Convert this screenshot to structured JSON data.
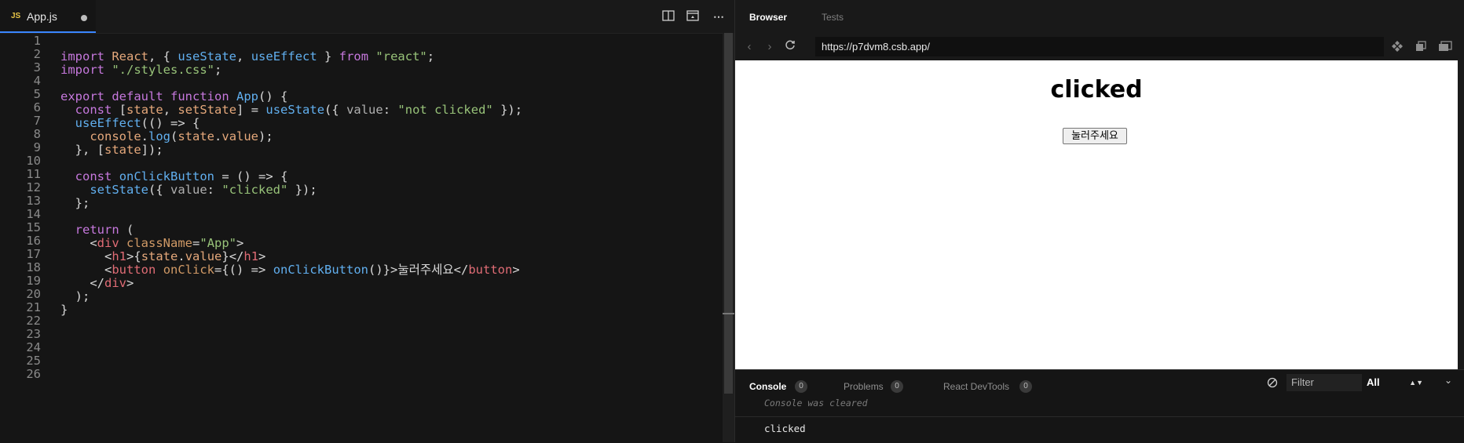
{
  "editor": {
    "tab": {
      "badge": "JS",
      "filename": "App.js"
    },
    "line_numbers": [
      "1",
      "2",
      "3",
      "4",
      "5",
      "6",
      "7",
      "8",
      "9",
      "10",
      "11",
      "12",
      "13",
      "14",
      "15",
      "16",
      "17",
      "18",
      "19",
      "20",
      "21",
      "22",
      "23",
      "24",
      "25",
      "26"
    ],
    "code": {
      "l1": [
        "import",
        "React",
        ", {",
        "useState",
        ",",
        "useEffect",
        "}",
        "from",
        "\"react\"",
        ";"
      ],
      "l2": [
        "import",
        "\"./styles.css\"",
        ";"
      ],
      "l4": [
        "export",
        "default",
        "function",
        "App",
        "() {"
      ],
      "l5": [
        "const",
        "[",
        "state",
        ",",
        "setState",
        "] =",
        "useState",
        "({",
        "value",
        ":",
        "\"not clicked\"",
        "});"
      ],
      "l6": [
        "useEffect",
        "(() =>",
        "{"
      ],
      "l7": [
        "console",
        ".",
        "log",
        "(",
        "state",
        ".",
        "value",
        ");"
      ],
      "l8": [
        "}, [",
        "state",
        "]);"
      ],
      "l10": [
        "const",
        "onClickButton",
        "=",
        "() =>",
        "{"
      ],
      "l11": [
        "setState",
        "({",
        "value",
        ":",
        "\"clicked\"",
        "});"
      ],
      "l12": [
        "};"
      ],
      "l14": [
        "return",
        "("
      ],
      "l15": [
        "<",
        "div",
        "className",
        "=",
        "\"App\"",
        ">"
      ],
      "l16": [
        "<",
        "h1",
        ">{",
        "state",
        ".",
        "value",
        "}</",
        "h1",
        ">"
      ],
      "l17": [
        "<",
        "button",
        "onClick",
        "={() =>",
        "onClickButton",
        "()}>",
        "눌러주세요",
        "</",
        "button",
        ">"
      ],
      "l18": [
        "</",
        "div",
        ">"
      ],
      "l19": [
        ");"
      ],
      "l20": [
        "}"
      ]
    }
  },
  "browser": {
    "tabs": [
      "Browser",
      "Tests"
    ],
    "url": "https://p7dvm8.csb.app/",
    "preview": {
      "heading": "clicked",
      "button_label": "눌러주세요"
    }
  },
  "console": {
    "tabs": [
      {
        "label": "Console",
        "count": "0"
      },
      {
        "label": "Problems",
        "count": "0"
      },
      {
        "label": "React DevTools",
        "count": "0"
      }
    ],
    "filter_placeholder": "Filter",
    "level_select": "All",
    "cleared_message": "Console was cleared",
    "log": "clicked"
  },
  "colors": {
    "accent": "#3a86ff",
    "background": "#151515",
    "string": "#98c379",
    "keyword": "#c678dd",
    "function": "#61afef"
  }
}
